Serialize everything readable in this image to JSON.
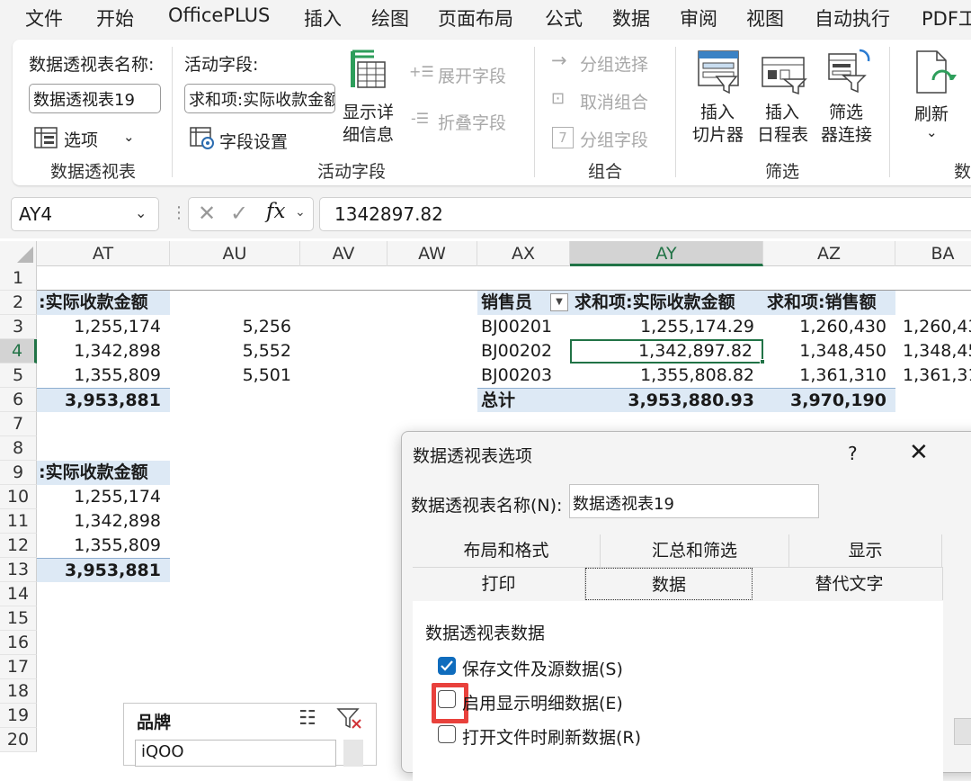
{
  "menu": [
    "文件",
    "开始",
    "OfficePLUS",
    "插入",
    "绘图",
    "页面布局",
    "公式",
    "数据",
    "审阅",
    "视图",
    "自动执行",
    "PDF工"
  ],
  "ribbon": {
    "pivot_name_label": "数据透视表名称:",
    "pivot_name_value": "数据透视表19",
    "options_label": "选项",
    "group_pivot": "数据透视表",
    "active_field_label": "活动字段:",
    "active_field_value": "求和项:实际收款金额",
    "field_settings": "字段设置",
    "show_detail_line1": "显示详",
    "show_detail_line2": "细信息",
    "expand_field": "展开字段",
    "collapse_field": "折叠字段",
    "group_active_field": "活动字段",
    "group_selection": "分组选择",
    "ungroup": "取消组合",
    "group_field": "分组字段",
    "group_group": "组合",
    "insert_slicer_line1": "插入",
    "insert_slicer_line2": "切片器",
    "insert_timeline_line1": "插入",
    "insert_timeline_line2": "日程表",
    "filter_conn_line1": "筛选",
    "filter_conn_line2": "器连接",
    "group_filter": "筛选",
    "refresh": "刷新",
    "group_data_partial": "数"
  },
  "formula_bar": {
    "name_box": "AY4",
    "fx": "fx",
    "formula": "1342897.82"
  },
  "columns": [
    "AT",
    "AU",
    "AV",
    "AW",
    "AX",
    "AY",
    "AZ",
    "BA"
  ],
  "rows": [
    "1",
    "2",
    "3",
    "4",
    "5",
    "6",
    "7",
    "8",
    "9",
    "10",
    "11",
    "12",
    "13",
    "14",
    "15",
    "16",
    "17",
    "18",
    "19",
    "20"
  ],
  "left_table1": {
    "header": ":实际收款金额",
    "values": [
      "1,255,174",
      "1,342,898",
      "1,355,809"
    ],
    "total": "3,953,881",
    "au_values": [
      "5,256",
      "5,552",
      "5,501"
    ]
  },
  "left_table2": {
    "header": ":实际收款金额",
    "values": [
      "1,255,174",
      "1,342,898",
      "1,355,809"
    ],
    "total": "3,953,881"
  },
  "pivot": {
    "col1": "销售员",
    "col2": "求和项:实际收款金额",
    "col3": "求和项:销售额",
    "rows": [
      {
        "name": "BJ00201",
        "amount": "1,255,174.29",
        "sales": "1,260,430",
        "extra": "1,260,43"
      },
      {
        "name": "BJ00202",
        "amount": "1,342,897.82",
        "sales": "1,348,450",
        "extra": "1,348,45"
      },
      {
        "name": "BJ00203",
        "amount": "1,355,808.82",
        "sales": "1,361,310",
        "extra": "1,361,31"
      }
    ],
    "total_label": "总计",
    "total_amount": "3,953,880.93",
    "total_sales": "3,970,190"
  },
  "dialog": {
    "title": "数据透视表选项",
    "help": "?",
    "name_label": "数据透视表名称(N):",
    "name_value": "数据透视表19",
    "tabs_row1": [
      "布局和格式",
      "汇总和筛选",
      "显示"
    ],
    "tabs_row2": [
      "打印",
      "数据",
      "替代文字"
    ],
    "section_title": "数据透视表数据",
    "options": [
      {
        "label": "保存文件及源数据(S)",
        "checked": true
      },
      {
        "label": "启用显示明细数据(E)",
        "checked": false
      },
      {
        "label": "打开文件时刷新数据(R)",
        "checked": false
      }
    ],
    "highlight_color": "#e8413c"
  },
  "slicer": {
    "title": "品牌",
    "first_item": "iQOO"
  },
  "colors": {
    "accent_green": "#217346",
    "header_fill": "#dde9f5",
    "check_blue": "#0f6cbd"
  }
}
